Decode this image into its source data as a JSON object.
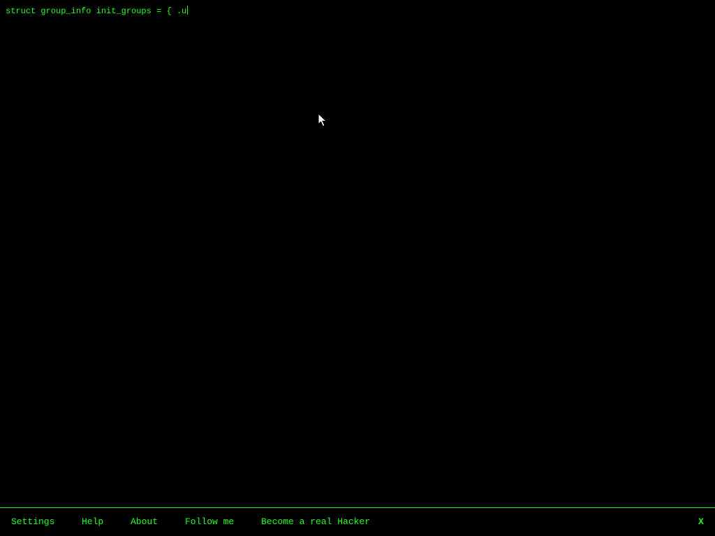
{
  "terminal": {
    "code_text": "struct group_info init_groups = { .u"
  },
  "menu": {
    "items": [
      {
        "label": "Settings"
      },
      {
        "label": "Help"
      },
      {
        "label": "About"
      },
      {
        "label": "Follow me"
      },
      {
        "label": "Become a real Hacker"
      }
    ],
    "close_label": "X"
  },
  "colors": {
    "background": "#000000",
    "text_green": "#22ff22",
    "border_green": "#1aff1a"
  },
  "icons": {
    "pointer": "mouse-pointer-icon",
    "caret": "text-caret-icon"
  }
}
